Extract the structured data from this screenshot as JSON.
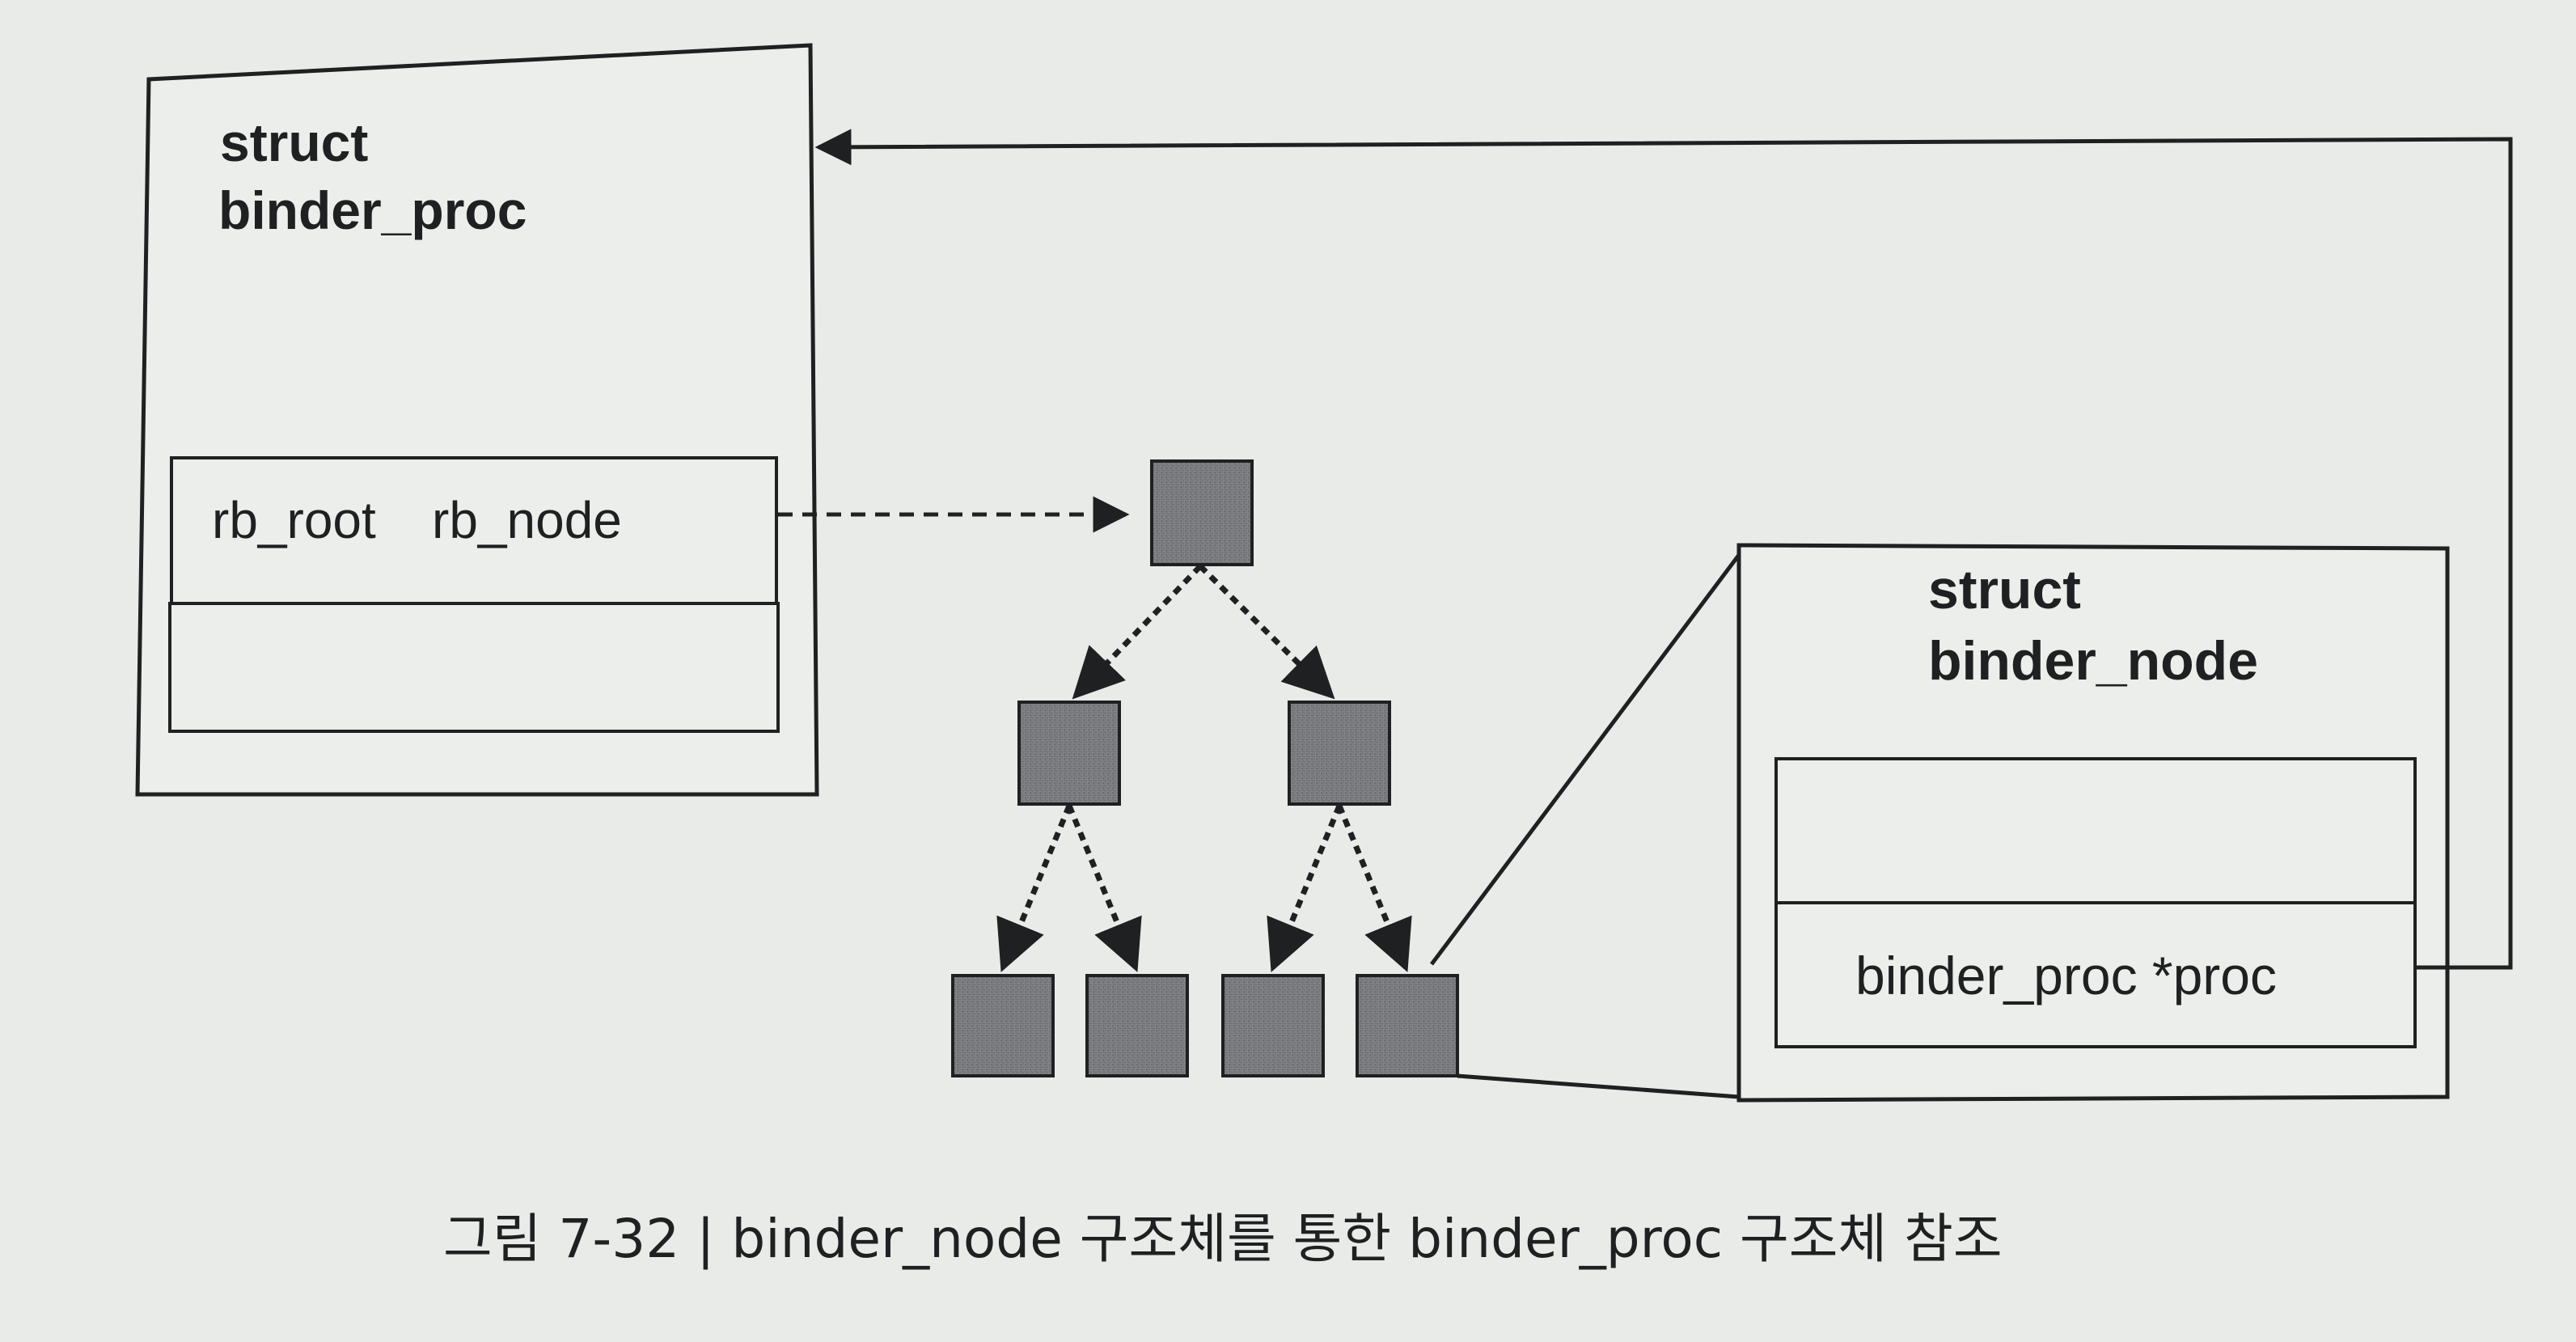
{
  "diagram": {
    "binder_proc_box": {
      "title_line1": "struct",
      "title_line2": "binder_proc",
      "field_rb_root": "rb_root",
      "field_rb_node": "rb_node"
    },
    "binder_node_box": {
      "title_line1": "struct",
      "title_line2": "binder_node",
      "field_proc": "binder_proc *proc"
    },
    "tree": {
      "node_fill": "#7b7d80",
      "levels": [
        1,
        2,
        4
      ]
    },
    "caption": "그림 7-32  |  binder_node 구조체를 통한 binder_proc 구조체 참조"
  },
  "colors": {
    "background": "#e9ebe8",
    "box_fill": "#eceeeb",
    "line": "#1f2022"
  }
}
